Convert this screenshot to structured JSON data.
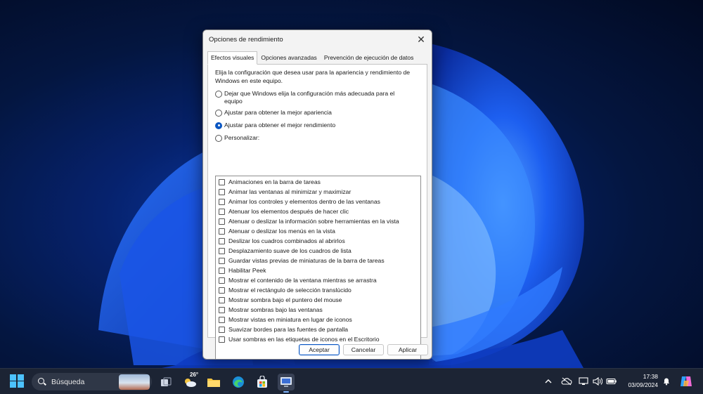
{
  "dialog": {
    "title": "Opciones de rendimiento",
    "tabs": [
      {
        "label": "Efectos visuales",
        "active": true
      },
      {
        "label": "Opciones avanzadas",
        "active": false
      },
      {
        "label": "Prevención de ejecución de datos",
        "active": false
      }
    ],
    "description": "Elija la configuración que desea usar para la apariencia y rendimiento de Windows en este equipo.",
    "radios": [
      {
        "label_line1": "Dejar que Windows elija la configuración más adecuada para el",
        "label_line2": "equipo",
        "checked": false
      },
      {
        "label_line1": "Ajustar para obtener la mejor apariencia",
        "checked": false
      },
      {
        "label_line1": "Ajustar para obtener el mejor rendimiento",
        "checked": true
      },
      {
        "label_line1": "Personalizar:",
        "checked": false
      }
    ],
    "options": [
      "Animaciones en la barra de tareas",
      "Animar las ventanas al minimizar y maximizar",
      "Animar los controles y elementos dentro de las ventanas",
      "Atenuar los elementos después de hacer clic",
      "Atenuar o deslizar la información sobre herramientas en la vista",
      "Atenuar o deslizar los menús en la vista",
      "Deslizar los cuadros combinados al abrirlos",
      "Desplazamiento suave de los cuadros de lista",
      "Guardar vistas previas de miniaturas de la barra de tareas",
      "Habilitar Peek",
      "Mostrar el contenido de la ventana mientras se arrastra",
      "Mostrar el rectángulo de selección translúcido",
      "Mostrar sombra bajo el puntero del mouse",
      "Mostrar sombras bajo las ventanas",
      "Mostrar vistas en miniatura en lugar de iconos",
      "Suavizar bordes para las fuentes de pantalla",
      "Usar sombras en las etiquetas de iconos en el Escritorio"
    ],
    "buttons": {
      "ok": "Aceptar",
      "cancel": "Cancelar",
      "apply": "Aplicar"
    }
  },
  "taskbar": {
    "search_label": "Búsqueda",
    "weather_temp": "26°",
    "time": "17:38",
    "date": "03/09/2024",
    "accent": "#4cc2ff"
  }
}
